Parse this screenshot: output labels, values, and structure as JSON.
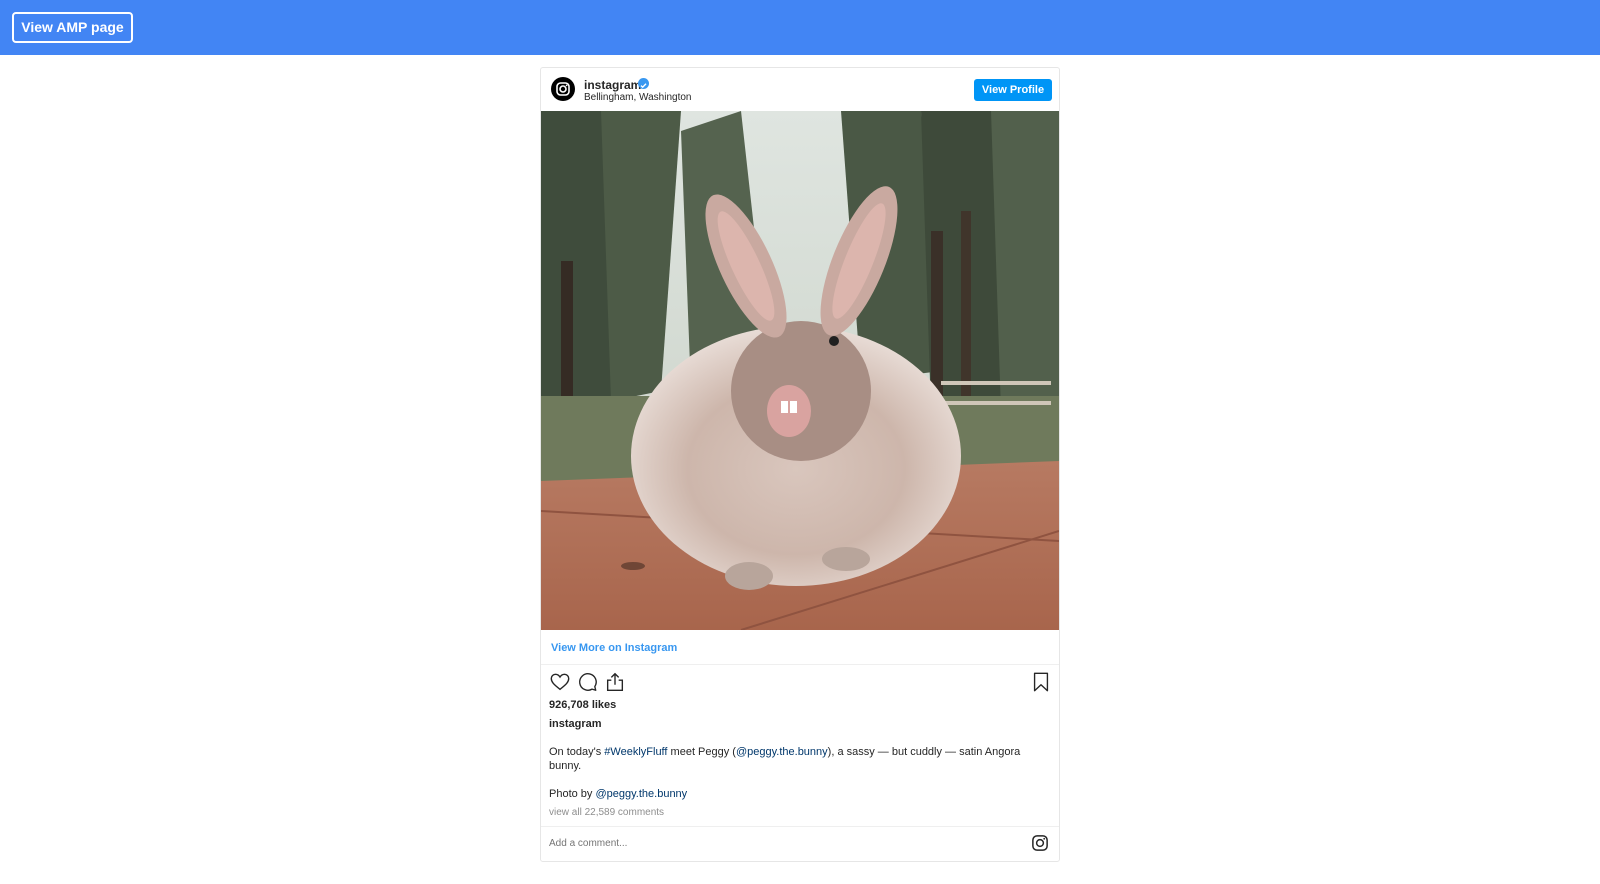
{
  "topbar": {
    "amp_button_label": "View AMP page",
    "bg_color": "#4285f4"
  },
  "post": {
    "username": "instagram",
    "verified": true,
    "location": "Bellingham, Washington",
    "view_profile_label": "View Profile",
    "photo_subject": "fluffy angora bunny on wooden table",
    "view_more_label": "View More on Instagram",
    "likes": "926,708 likes",
    "caption_user": "instagram",
    "caption": {
      "part1": "On today's ",
      "hashtag": "#WeeklyFluff",
      "part2": " meet Peggy (",
      "mention": "@peggy.the.bunny",
      "part3": "), a sassy — but cuddly — satin Angora bunny."
    },
    "photo_by": {
      "prefix": "Photo by ",
      "mention": "@peggy.the.bunny"
    },
    "view_all_comments": "view all 22,589 comments",
    "add_comment_placeholder": "Add a comment...",
    "icons": [
      "heart-icon",
      "comment-icon",
      "share-icon",
      "bookmark-icon",
      "instagram-icon"
    ],
    "accent_color": "#0095f6",
    "link_color": "#3897f0"
  }
}
